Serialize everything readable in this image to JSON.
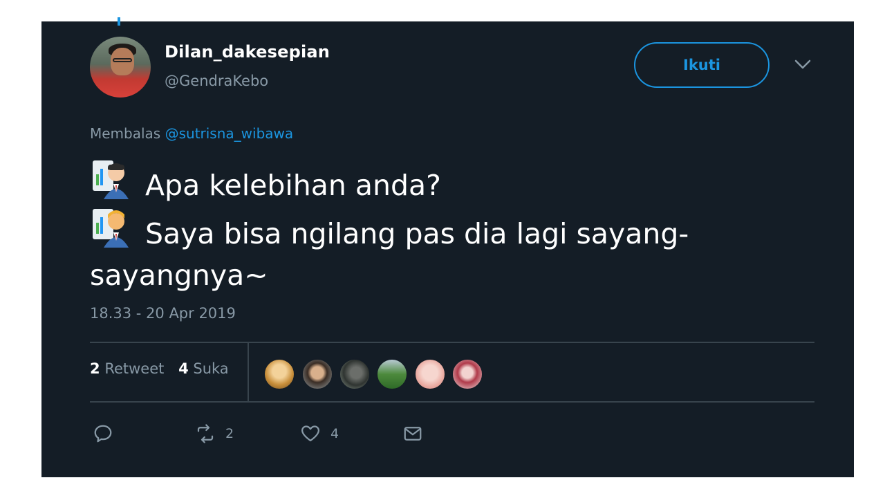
{
  "tweet": {
    "display_name": "Dilan_dakesepian",
    "handle": "@GendraKebo",
    "follow_label": "Ikuti",
    "reply_prefix": "Membalas",
    "reply_mention": "@sutrisna_wibawa",
    "lines": [
      {
        "emoji": "man-office-worker-emoji",
        "text": "Apa kelebihan anda?"
      },
      {
        "emoji": "blond-man-office-worker-emoji",
        "text": "Saya bisa ngilang pas dia lagi sayang-sayangnya~"
      }
    ],
    "timestamp": "18.33 - 20 Apr 2019",
    "stats": {
      "retweet_count": "2",
      "retweet_label": "Retweet",
      "like_count": "4",
      "like_label": "Suka"
    },
    "actions": {
      "reply_icon": "reply-icon",
      "retweet_icon": "retweet-icon",
      "retweet_count": "2",
      "like_icon": "heart-icon",
      "like_count": "4",
      "dm_icon": "envelope-icon"
    },
    "likers_count": 6
  },
  "colors": {
    "background": "#141d26",
    "accent": "#1b95e0",
    "muted": "#8899a6",
    "divider": "#38444d",
    "text": "#ffffff"
  }
}
